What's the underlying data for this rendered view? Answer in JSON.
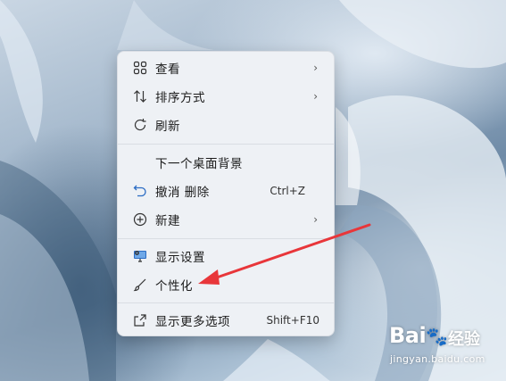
{
  "menu": {
    "items": [
      {
        "label": "查看",
        "icon": "grid-icon",
        "submenu": true
      },
      {
        "label": "排序方式",
        "icon": "sort-icon",
        "submenu": true
      },
      {
        "label": "刷新",
        "icon": "refresh-icon"
      },
      {
        "label": "下一个桌面背景",
        "icon": ""
      },
      {
        "label": "撤消 删除",
        "icon": "undo-icon",
        "shortcut": "Ctrl+Z"
      },
      {
        "label": "新建",
        "icon": "plus-circle-icon",
        "submenu": true
      },
      {
        "label": "显示设置",
        "icon": "display-settings-icon"
      },
      {
        "label": "个性化",
        "icon": "brush-icon"
      },
      {
        "label": "显示更多选项",
        "icon": "share-icon",
        "shortcut": "Shift+F10"
      }
    ],
    "chevron": "›"
  },
  "watermark": {
    "brand": "Bai",
    "brand2": "经验",
    "url": "jingyan.baidu.com"
  },
  "colors": {
    "annotation_arrow": "#e8363a",
    "menu_bg": "#eef1f5"
  }
}
